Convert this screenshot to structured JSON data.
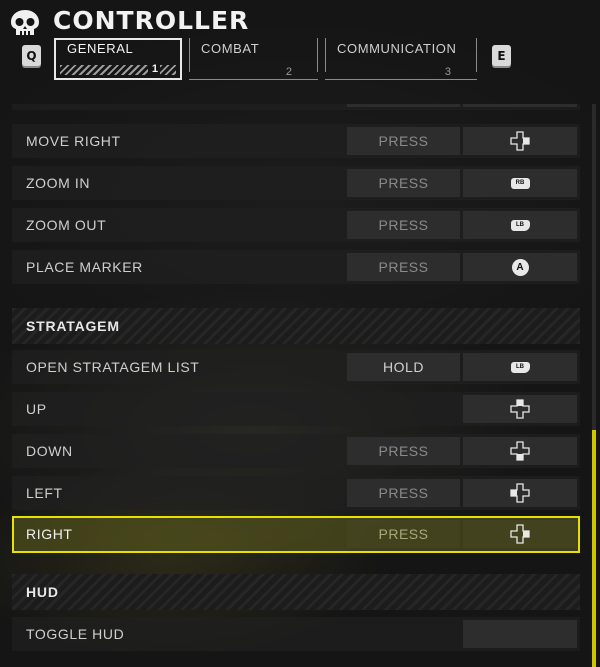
{
  "header": {
    "title": "CONTROLLER",
    "prev_key": "Q",
    "next_key": "E",
    "tabs": [
      {
        "label": "GENERAL",
        "number": "1",
        "active": true
      },
      {
        "label": "COMBAT",
        "number": "2",
        "active": false
      },
      {
        "label": "COMMUNICATION",
        "number": "3",
        "active": false
      }
    ]
  },
  "rows": [
    {
      "label": "MOVE RIGHT",
      "mode": "PRESS",
      "binding_icon": "dpad-right-icon"
    },
    {
      "label": "ZOOM IN",
      "mode": "PRESS",
      "binding": "RB"
    },
    {
      "label": "ZOOM OUT",
      "mode": "PRESS",
      "binding": "LB"
    },
    {
      "label": "PLACE MARKER",
      "mode": "PRESS",
      "binding": "A"
    },
    {
      "label": "STRATAGEM"
    },
    {
      "label": "OPEN STRATAGEM LIST",
      "mode": "HOLD",
      "binding": "LB"
    },
    {
      "label": "UP",
      "binding_icon": "dpad-up-icon"
    },
    {
      "label": "DOWN",
      "mode": "PRESS",
      "binding_icon": "dpad-down-icon"
    },
    {
      "label": "LEFT",
      "mode": "PRESS",
      "binding_icon": "dpad-left-icon"
    },
    {
      "label": "RIGHT",
      "mode": "PRESS",
      "binding_icon": "dpad-right-icon",
      "selected": true
    },
    {
      "label": "HUD"
    },
    {
      "label": "TOGGLE HUD"
    }
  ],
  "colors": {
    "accent": "#e6e100",
    "scroll_thumb": "#cfc600"
  }
}
